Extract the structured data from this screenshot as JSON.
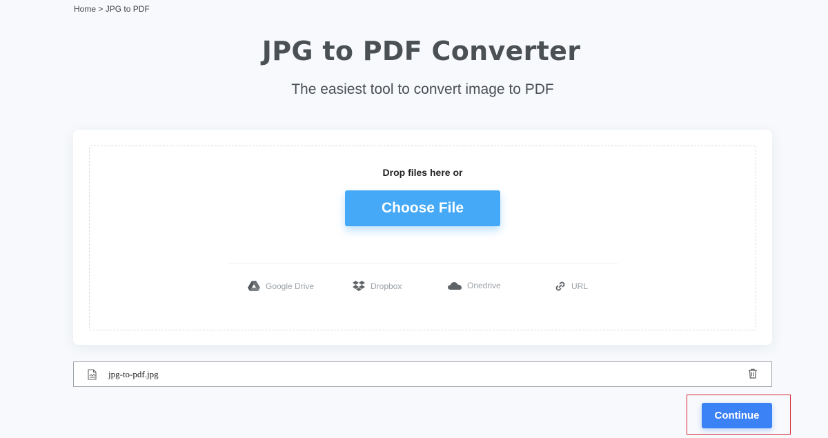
{
  "breadcrumb": {
    "home": "Home",
    "separator": ">",
    "current": "JPG to PDF"
  },
  "header": {
    "title": "JPG to PDF Converter",
    "subtitle": "The easiest tool to convert image to PDF"
  },
  "upload": {
    "drop_text": "Drop files here or",
    "choose_label": "Choose File",
    "sources": [
      {
        "label": "Google Drive",
        "icon": "google-drive-icon"
      },
      {
        "label": "Dropbox",
        "icon": "dropbox-icon"
      },
      {
        "label": "Onedrive",
        "icon": "onedrive-icon"
      },
      {
        "label": "URL",
        "icon": "link-icon"
      }
    ]
  },
  "files": [
    {
      "name": "jpg-to-pdf.jpg",
      "icon": "file-image-icon",
      "action_icon": "trash-icon"
    }
  ],
  "actions": {
    "continue_label": "Continue"
  },
  "colors": {
    "choose_button": "#45a9f7",
    "continue_button": "#3b82f6",
    "highlight": "#d6242c",
    "background": "#f7f9fc"
  }
}
